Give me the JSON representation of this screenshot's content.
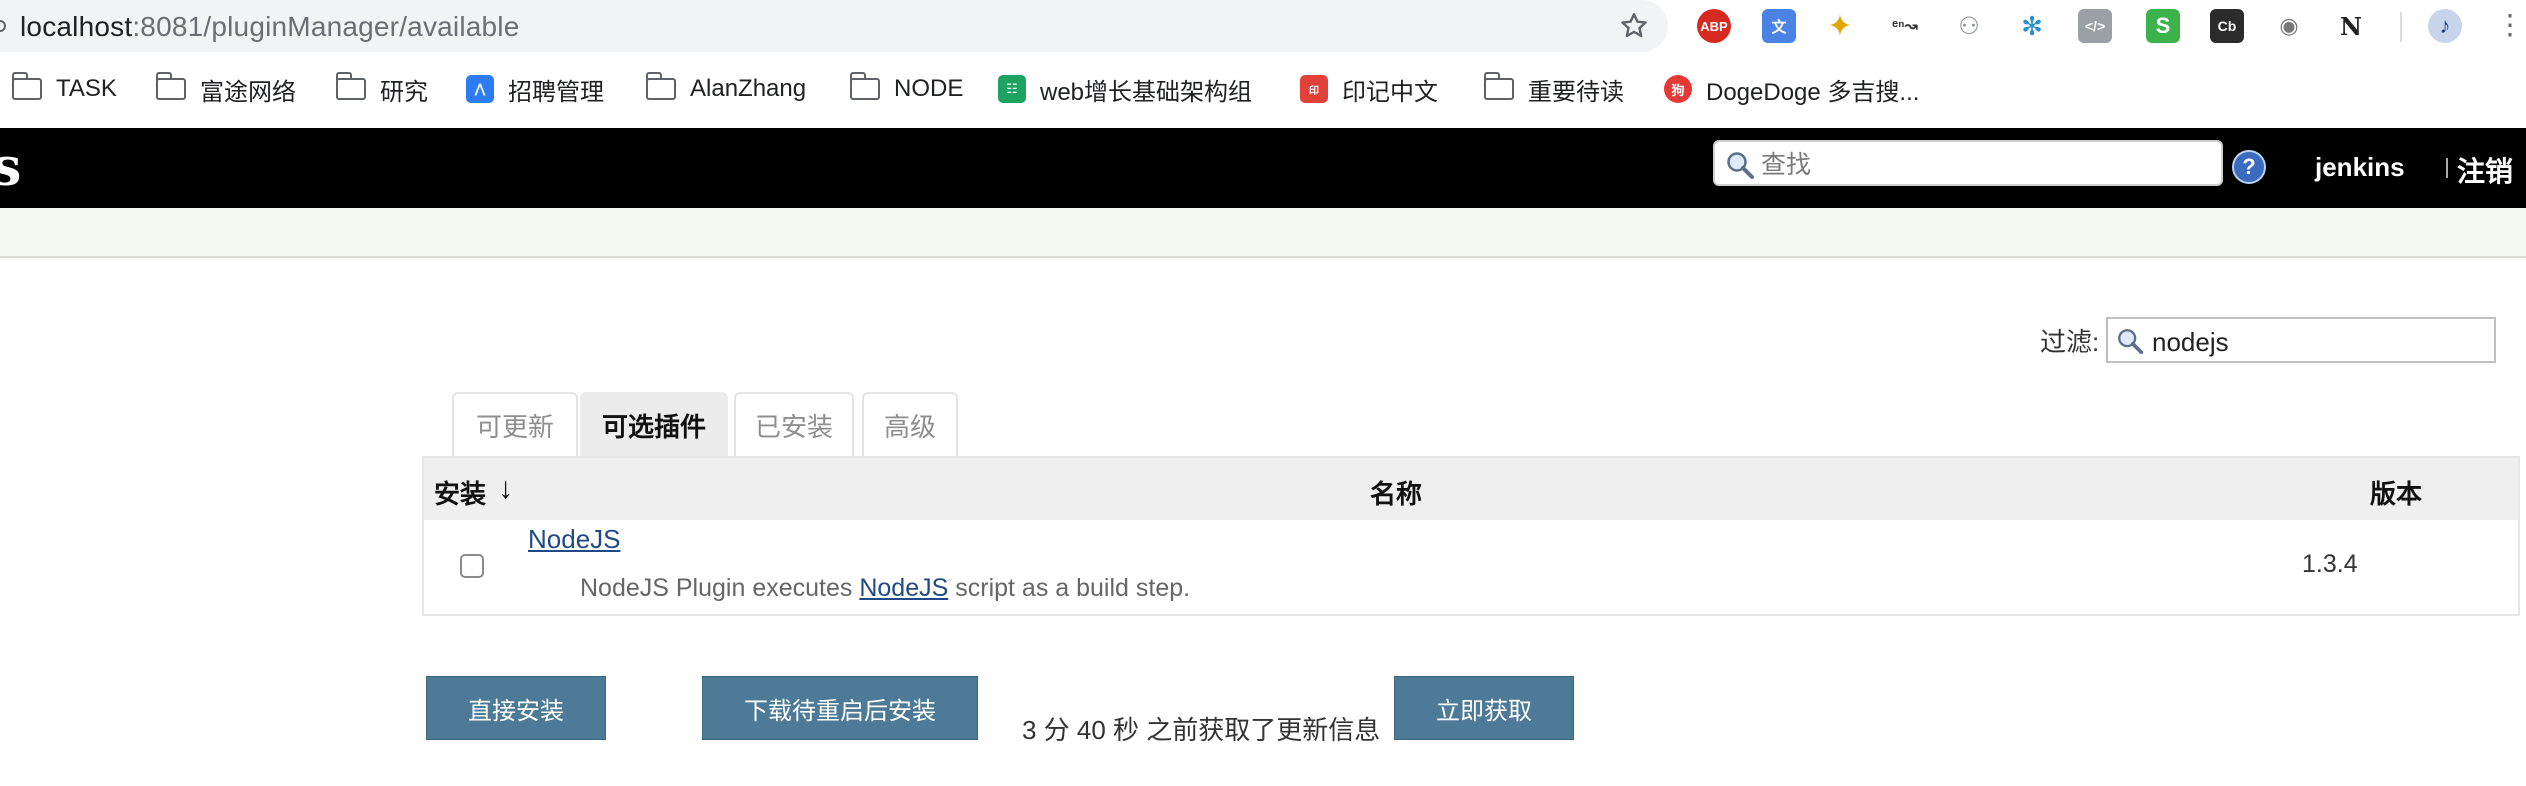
{
  "browser": {
    "url_host": "localhost",
    "url_path": ":8081/pluginManager/available",
    "extensions": {
      "abp": "ABP",
      "translate": "文",
      "code": "</>",
      "s": "S",
      "cb": "Cb",
      "n": "N"
    },
    "bookmarks": [
      {
        "label": "TASK",
        "icon": "folder-icon"
      },
      {
        "label": "富途网络",
        "icon": "folder-icon"
      },
      {
        "label": "研究",
        "icon": "folder-icon"
      },
      {
        "label": "招聘管理",
        "icon": "moka-icon"
      },
      {
        "label": "AlanZhang",
        "icon": "folder-icon"
      },
      {
        "label": "NODE",
        "icon": "folder-icon"
      },
      {
        "label": "web增长基础架构组",
        "icon": "sheet-icon"
      },
      {
        "label": "印记中文",
        "icon": "yinji-icon"
      },
      {
        "label": "重要待读",
        "icon": "folder-icon"
      },
      {
        "label": "DogeDoge 多吉搜...",
        "icon": "dogedoge-icon"
      }
    ]
  },
  "header": {
    "logo_text": "s",
    "search_placeholder": "查找",
    "help_glyph": "?",
    "user": "jenkins",
    "logout": "注销"
  },
  "filter": {
    "label": "过滤:",
    "value": "nodejs"
  },
  "tabs": [
    {
      "label": "可更新",
      "active": false
    },
    {
      "label": "可选插件",
      "active": true
    },
    {
      "label": "已安装",
      "active": false
    },
    {
      "label": "高级",
      "active": false
    }
  ],
  "table": {
    "headers": {
      "install": "安装",
      "sort_arrow": "↓",
      "name": "名称",
      "version": "版本"
    },
    "rows": [
      {
        "name": "NodeJS",
        "desc_prefix": "NodeJS Plugin executes ",
        "desc_link": "NodeJS",
        "desc_suffix": " script as a build step.",
        "version": "1.3.4",
        "checked": false
      }
    ]
  },
  "actions": {
    "install_now": "直接安装",
    "download_restart": "下载待重启后安装",
    "update_info": "3 分 40 秒 之前获取了更新信息",
    "fetch_now": "立即获取"
  },
  "colors": {
    "header_bg": "#000000",
    "button_bg": "#4d7a96",
    "link": "#204a87"
  }
}
